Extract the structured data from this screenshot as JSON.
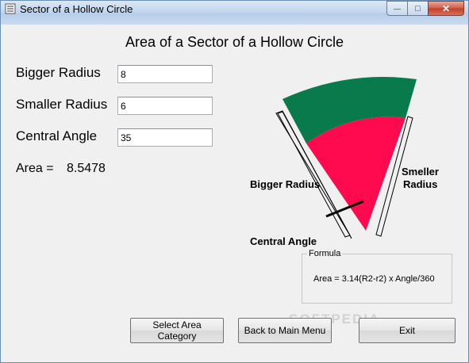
{
  "window": {
    "title": "Sector of a Hollow Circle",
    "close_glyph": "✕",
    "min_glyph": "—",
    "max_glyph": "□"
  },
  "heading": "Area of a Sector of a Hollow Circle",
  "inputs": {
    "bigger_radius": {
      "label": "Bigger Radius",
      "value": "8"
    },
    "smaller_radius": {
      "label": "Smaller Radius",
      "value": "6"
    },
    "central_angle": {
      "label": "Central Angle",
      "value": "35"
    }
  },
  "result": {
    "label": "Area  =",
    "value": "8.5478"
  },
  "diagram": {
    "bigger_label": "Bigger Radius",
    "smaller_label_line1": "Smeller",
    "smaller_label_line2": "Radius",
    "angle_label": "Central Angle",
    "colors": {
      "ring": "#087a4c",
      "inner": "#ff0a4e",
      "outline": "#000000"
    }
  },
  "formula": {
    "legend": "Formula",
    "text": "Area = 3.14(R2-r2) x Angle/360"
  },
  "buttons": {
    "select_area_category": "Select Area Category",
    "back_to_main_menu": "Back to Main Menu",
    "exit": "Exit"
  },
  "watermark": "SOFTPEDIA"
}
